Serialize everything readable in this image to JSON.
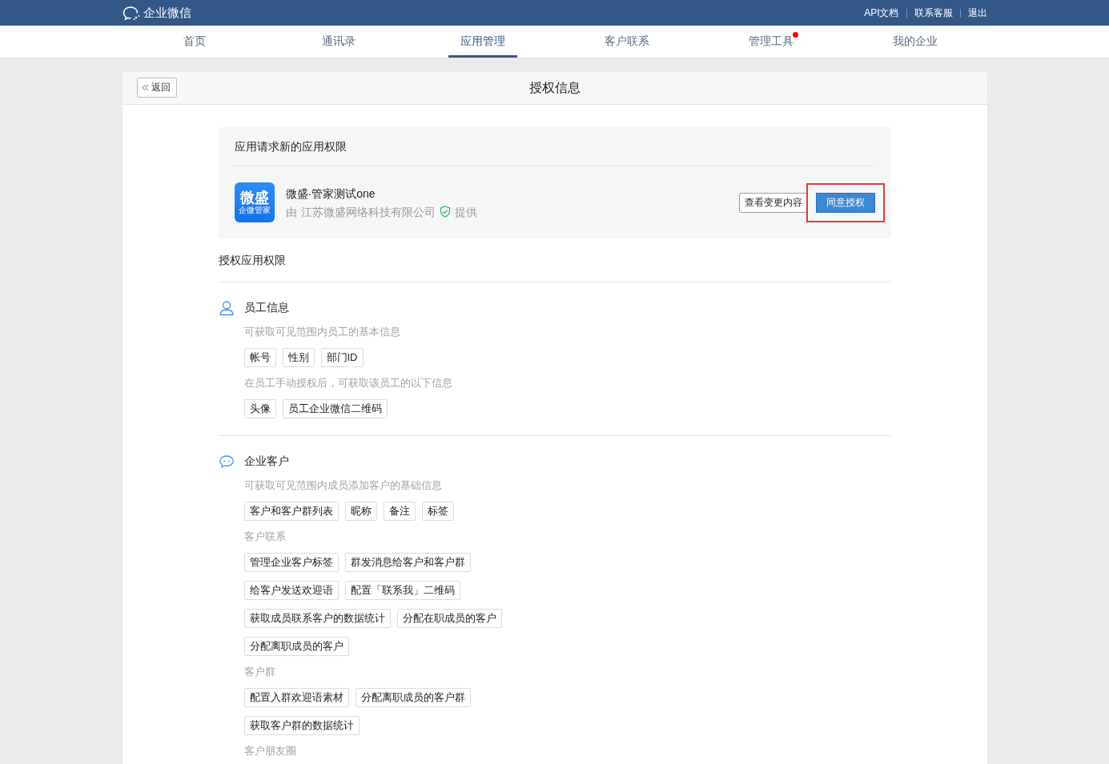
{
  "header": {
    "logo": "企业微信",
    "links": [
      "API文档",
      "联系客服",
      "退出"
    ]
  },
  "nav": [
    {
      "label": "首页",
      "selected": false,
      "dot": false
    },
    {
      "label": "通讯录",
      "selected": false,
      "dot": false
    },
    {
      "label": "应用管理",
      "selected": true,
      "dot": false
    },
    {
      "label": "客户联系",
      "selected": false,
      "dot": false
    },
    {
      "label": "管理工具",
      "selected": false,
      "dot": true
    },
    {
      "label": "我的企业",
      "selected": false,
      "dot": false
    }
  ],
  "page": {
    "back": "返回",
    "title": "授权信息"
  },
  "request": {
    "heading": "应用请求新的应用权限",
    "app": {
      "icon_title": "微盛",
      "icon_subtitle": "企微管家",
      "name": "微盛·管家测试one",
      "provider_prefix": "由",
      "provider": "江苏微盛网络科技有限公司",
      "provider_suffix": "提供",
      "verified": true
    },
    "buttons": [
      {
        "label": "查看变更内容",
        "kind": "secondary",
        "highlighted": false
      },
      {
        "label": "同意授权",
        "kind": "primary",
        "highlighted": true
      }
    ]
  },
  "permissions": {
    "heading": "授权应用权限",
    "sections": [
      {
        "kind": "person",
        "title": "员工信息",
        "groups": [
          {
            "note": "可获取可见范围内员工的基本信息",
            "tags": [
              "帐号",
              "性别",
              "部门ID"
            ]
          },
          {
            "note": "在员工手动授权后，可获取该员工的以下信息",
            "tags": [
              "头像",
              "员工企业微信二维码"
            ]
          }
        ]
      },
      {
        "kind": "chat",
        "title": "企业客户",
        "groups": [
          {
            "note": "可获取可见范围内成员添加客户的基础信息",
            "tags": [
              "客户和客户群列表",
              "昵称",
              "备注",
              "标签"
            ]
          },
          {
            "note": "客户联系",
            "tags": [
              "管理企业客户标签",
              "群发消息给客户和客户群",
              "给客户发送欢迎语",
              "配置「联系我」二维码",
              "获取成员联系客户的数据统计",
              "分配在职成员的客户",
              "分配离职成员的客户"
            ]
          },
          {
            "note": "客户群",
            "tags": [
              "配置入群欢迎语素材",
              "分配离职成员的客户群",
              "获取客户群的数据统计"
            ]
          },
          {
            "note": "客户朋友圈"
          }
        ]
      }
    ]
  }
}
